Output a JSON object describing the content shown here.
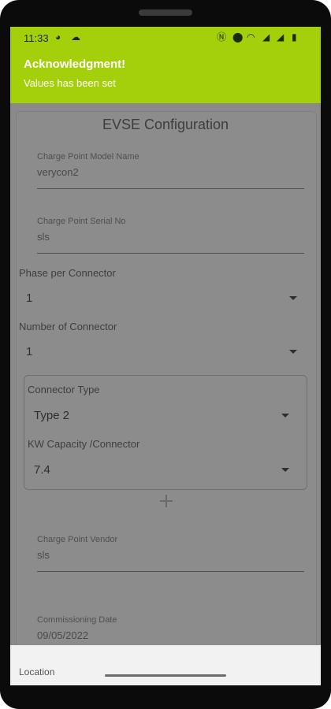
{
  "status_bar": {
    "time": "11:33",
    "left_icons": [
      "app-icon",
      "cloud-icon"
    ],
    "right_icons": [
      "nfc-icon",
      "location-icon",
      "wifi-icon",
      "signal-icon",
      "signal-icon",
      "battery-icon"
    ]
  },
  "notification": {
    "title": "Acknowledgment!",
    "message": "Values has been set",
    "color": "#a4cf0b"
  },
  "page": {
    "title": "EVSE Configuration"
  },
  "fields": {
    "model_name": {
      "label": "Charge Point Model Name",
      "value": "verycon2"
    },
    "serial_no": {
      "label": "Charge Point Serial No",
      "value": "sls"
    },
    "phase": {
      "label": "Phase per Connector",
      "value": "1"
    },
    "num_connector": {
      "label": "Number of Connector",
      "value": "1"
    },
    "connector_type": {
      "label": "Connector Type",
      "value": "Type 2"
    },
    "kw_capacity": {
      "label": "KW Capacity /Connector",
      "value": "7.4"
    },
    "vendor": {
      "label": "Charge Point Vendor",
      "value": "sls"
    },
    "commission_date": {
      "label": "Commissioning Date",
      "value": "09/05/2022"
    },
    "location": {
      "label": "Location"
    }
  }
}
